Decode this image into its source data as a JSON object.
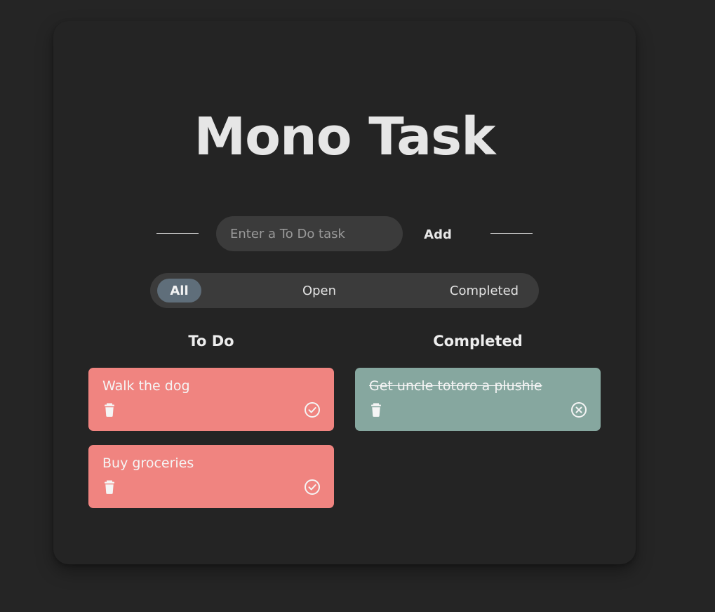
{
  "app": {
    "title": "Mono Task"
  },
  "entry": {
    "placeholder": "Enter a To Do task",
    "value": "",
    "add_label": "Add"
  },
  "filters": {
    "active": "All",
    "items": [
      {
        "label": "All"
      },
      {
        "label": "Open"
      },
      {
        "label": "Completed"
      }
    ]
  },
  "columns": {
    "todo": {
      "heading": "To Do",
      "tasks": [
        {
          "text": "Walk the dog",
          "delete_icon": "trash-icon",
          "action_icon": "check-circle-icon"
        },
        {
          "text": "Buy groceries",
          "delete_icon": "trash-icon",
          "action_icon": "check-circle-icon"
        }
      ]
    },
    "completed": {
      "heading": "Completed",
      "tasks": [
        {
          "text": "Get uncle totoro a plushie",
          "delete_icon": "trash-icon",
          "action_icon": "close-circle-icon"
        }
      ]
    }
  },
  "colors": {
    "background": "#252525",
    "todo_card": "#f08480",
    "completed_card": "#86a79f",
    "active_filter": "#5f6e7a"
  }
}
